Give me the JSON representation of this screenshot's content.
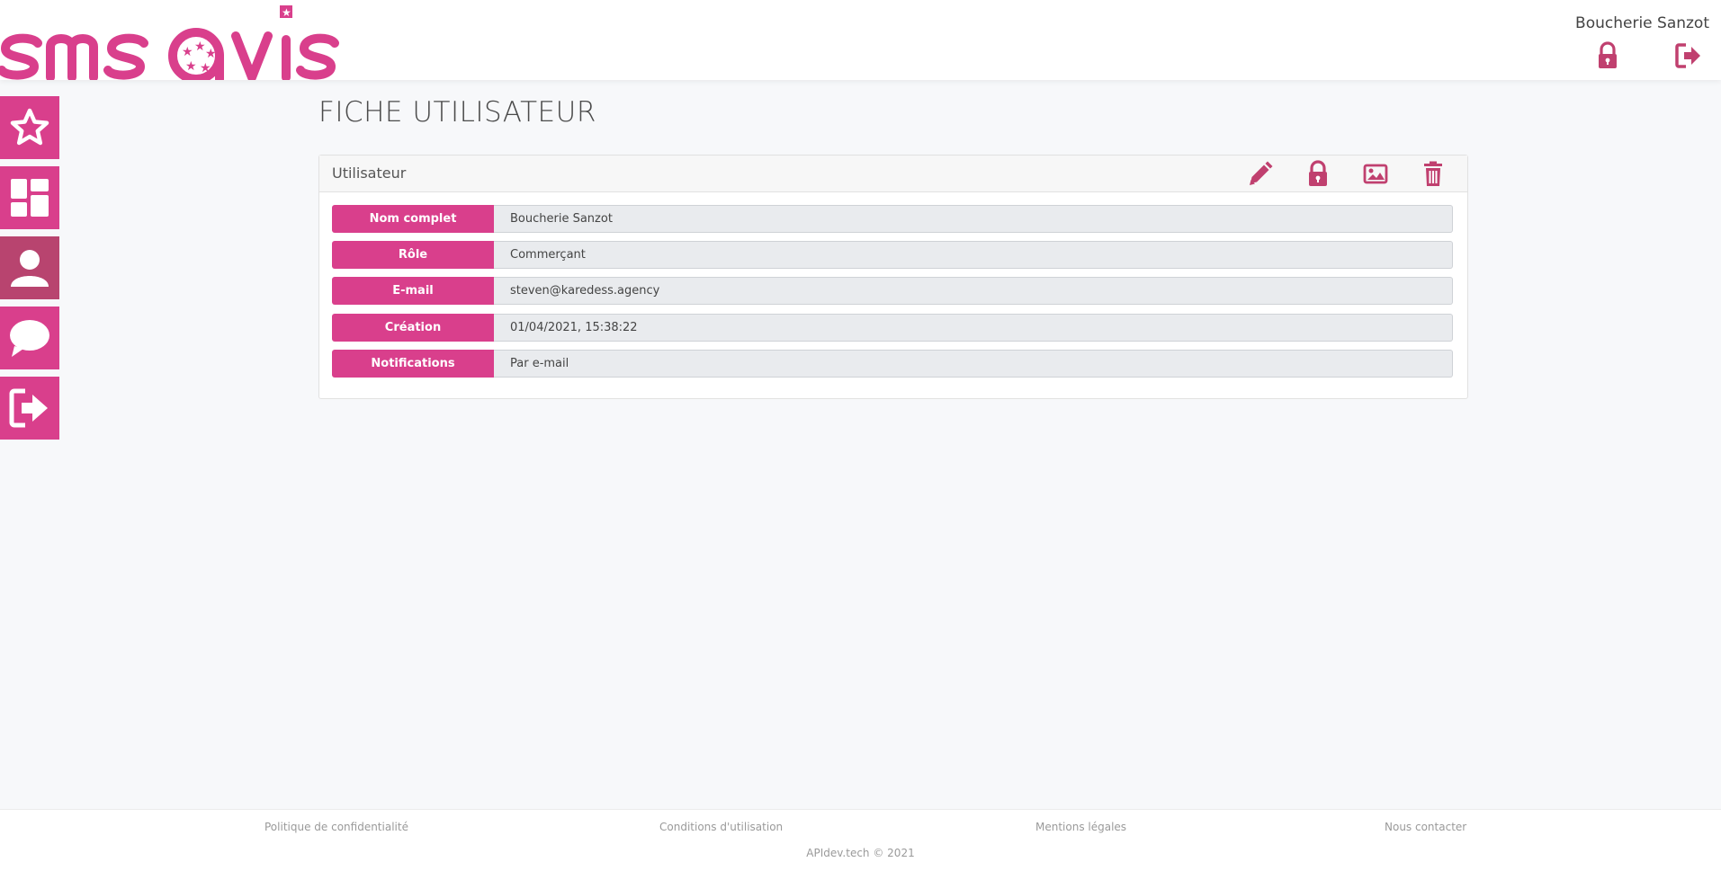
{
  "brand": {
    "logo_text": "smsavis",
    "accent": "#d93f8c",
    "accent_dark": "#b8446f"
  },
  "header": {
    "user_name": "Boucherie Sanzot",
    "icons": [
      "lock-icon",
      "logout-icon"
    ]
  },
  "sidebar": {
    "items": [
      {
        "icon": "star-icon",
        "active": false
      },
      {
        "icon": "dashboard-icon",
        "active": false
      },
      {
        "icon": "user-icon",
        "active": true
      },
      {
        "icon": "chat-icon",
        "active": false
      },
      {
        "icon": "logout-icon",
        "active": false
      }
    ]
  },
  "main": {
    "page_title": "FICHE UTILISATEUR",
    "card": {
      "title": "Utilisateur",
      "actions": [
        "edit-icon",
        "lock-icon",
        "image-icon",
        "trash-icon"
      ],
      "fields": [
        {
          "label": "Nom complet",
          "value": "Boucherie Sanzot"
        },
        {
          "label": "Rôle",
          "value": "Commerçant"
        },
        {
          "label": "E-mail",
          "value": "steven@karedess.agency"
        },
        {
          "label": "Création",
          "value": "01/04/2021, 15:38:22"
        },
        {
          "label": "Notifications",
          "value": "Par e-mail"
        }
      ]
    }
  },
  "footer": {
    "links": [
      "Politique de confidentialité",
      "Conditions d'utilisation",
      "Mentions légales",
      "Nous contacter"
    ],
    "copyright": "APIdev.tech © 2021"
  }
}
